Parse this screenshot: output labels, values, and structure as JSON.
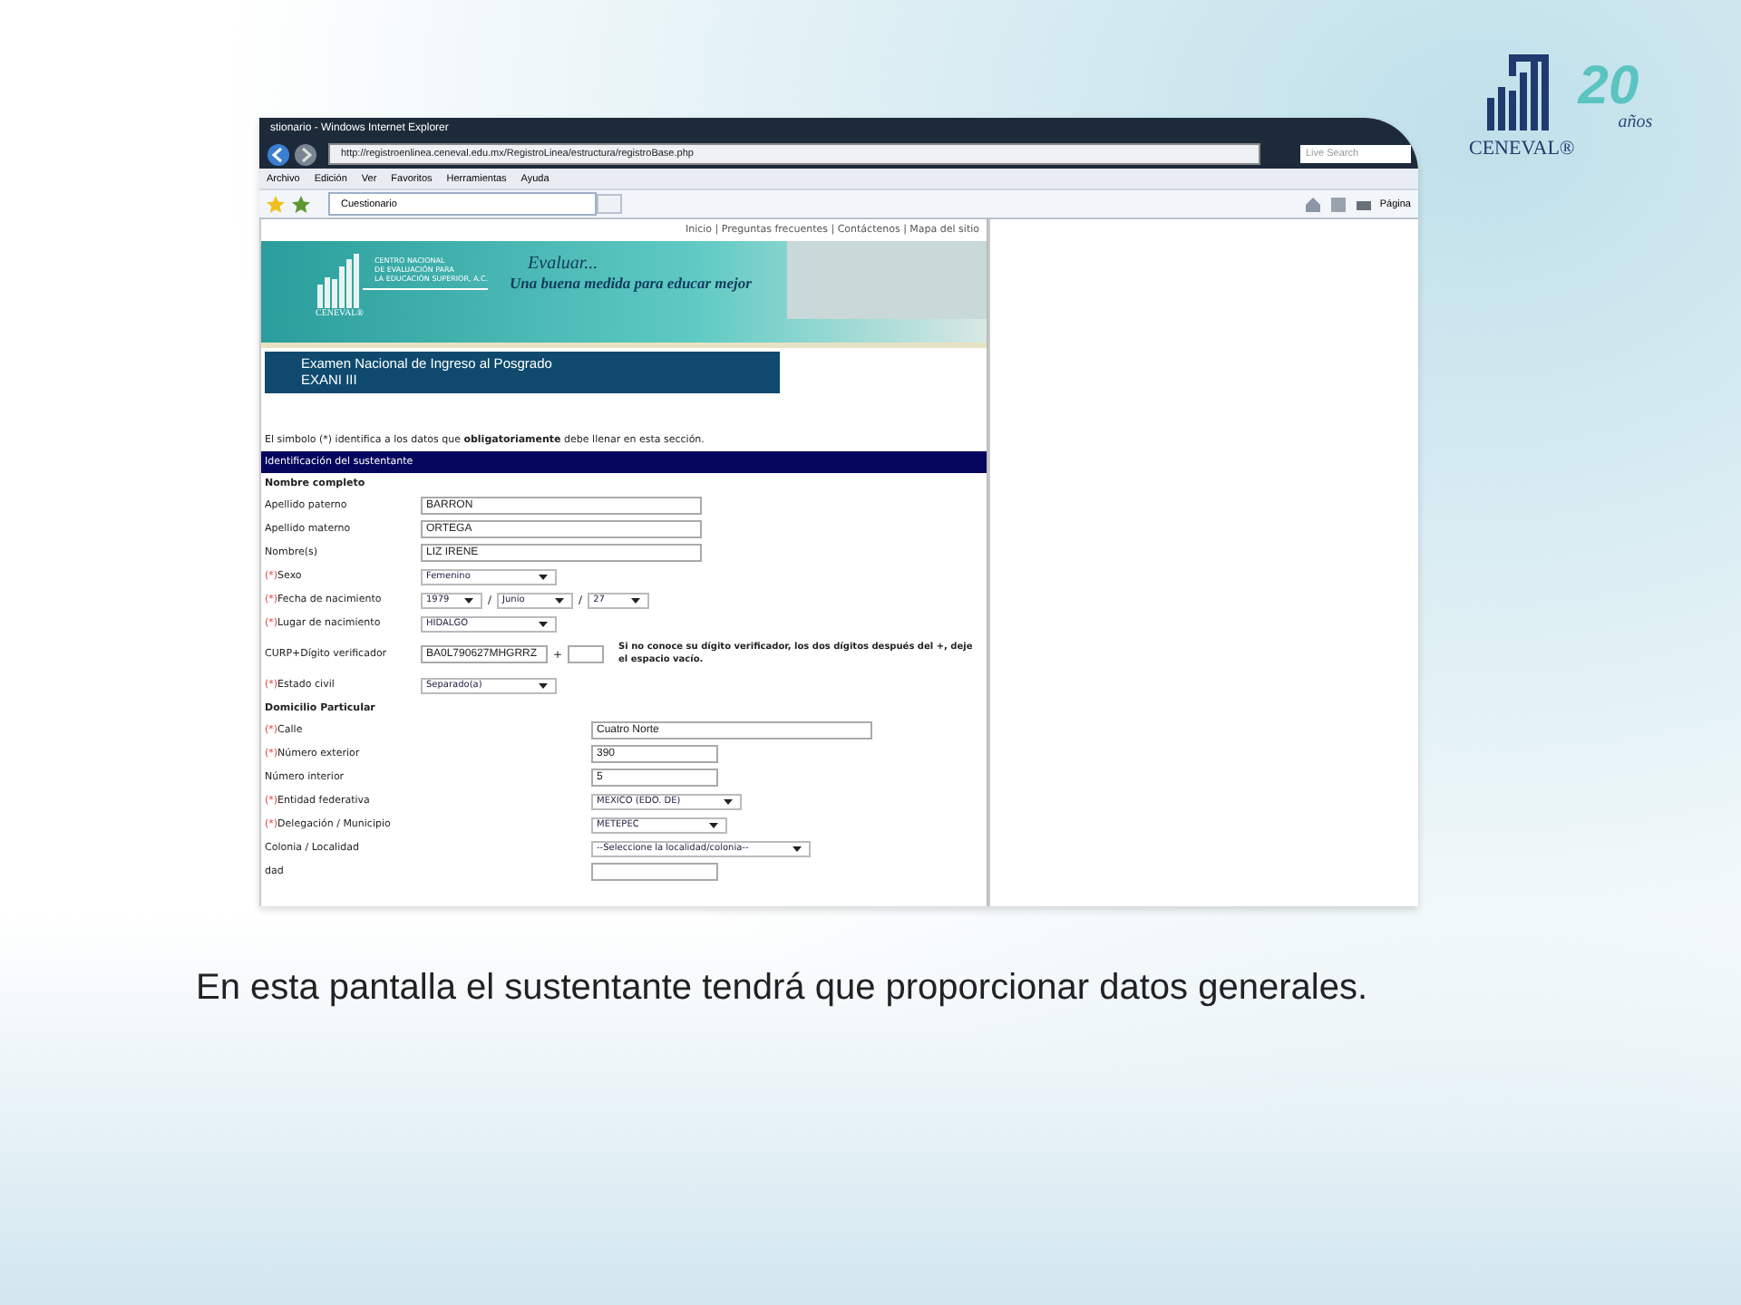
{
  "logo": {
    "name": "CENEVAL®",
    "badge": "20",
    "badge_sub": "años"
  },
  "browser": {
    "title": "stionario - Windows Internet Explorer",
    "address": "http://registroenlinea.ceneval.edu.mx/RegistroLinea/estructura/registroBase.php",
    "search_placeholder": "Live Search",
    "menu": [
      "Archivo",
      "Edición",
      "Ver",
      "Favoritos",
      "Herramientas",
      "Ayuda"
    ],
    "tab": "Cuestionario",
    "page_menu": "Página"
  },
  "site": {
    "top_links": "Inicio | Preguntas frecuentes | Contáctenos | Mapa del sitio",
    "org_lines": [
      "CENTRO NACIONAL",
      "DE EVALUACIÓN PARA",
      "LA EDUCACIÓN SUPERIOR, A.C."
    ],
    "org_logo": "CENEVAL®",
    "slogan": "Evaluar...",
    "slogan_sub": "Una buena medida para educar mejor",
    "exam": "Examen Nacional de Ingreso al Posgrado",
    "exam_code": "EXANI III",
    "notice": "El simbolo (*) identifica a los datos que **obligatoriamente** debe llenar en esta sección.",
    "section": "Identificación del sustentante",
    "groups": [
      {
        "title": "Nombre completo",
        "wide": false,
        "fields": [
          {
            "kind": "text",
            "label": "Apellido paterno",
            "value": "BARRON"
          },
          {
            "kind": "text",
            "label": "Apellido materno",
            "value": "ORTEGA"
          },
          {
            "kind": "text",
            "label": "Nombre(s)",
            "value": "LIZ IRENE"
          },
          {
            "kind": "select",
            "required_mark": "(*)",
            "label": "Sexo",
            "value": "Femenino"
          },
          {
            "kind": "date",
            "required_mark": "(*)",
            "label": "Fecha de nacimiento",
            "parts": [
              "1979",
              "Junio",
              "27"
            ],
            "separators": [
              "/",
              "/"
            ]
          },
          {
            "kind": "select",
            "required_mark": "(*)",
            "label": "Lugar de nacimiento",
            "value": "HIDALGO"
          },
          {
            "kind": "curp",
            "label": "CURP+Dígito verificador",
            "value": "BA0L790627MHGRRZ",
            "plus": "+",
            "hint": "Si no conoce su dígito verificador, los dos dígitos después del +, deje el espacio vacío."
          },
          {
            "kind": "select",
            "required_mark": "(*)",
            "label": "Estado civil",
            "value": "Separado(a)"
          }
        ]
      },
      {
        "title": "Domicilio Particular",
        "wide": true,
        "fields": [
          {
            "kind": "text",
            "required_mark": "(*)",
            "label": "Calle",
            "value": "Cuatro Norte"
          },
          {
            "kind": "short",
            "required_mark": "(*)",
            "label": "Número exterior",
            "value": "390"
          },
          {
            "kind": "short",
            "label": "Número interior",
            "value": "5"
          },
          {
            "kind": "select",
            "required_mark": "(*)",
            "label": "Entidad federativa",
            "value": "MEXICO (EDO. DE)"
          },
          {
            "kind": "select",
            "required_mark": "(*)",
            "label": "Delegación / Municipio",
            "value": "METEPEC"
          },
          {
            "kind": "select",
            "label": "Colonia / Localidad",
            "value": "--Seleccione la localidad/colonia--"
          },
          {
            "kind": "short",
            "label": "dad"
          }
        ]
      }
    ]
  },
  "caption": "En esta pantalla el sustentante tendrá que proporcionar datos generales."
}
